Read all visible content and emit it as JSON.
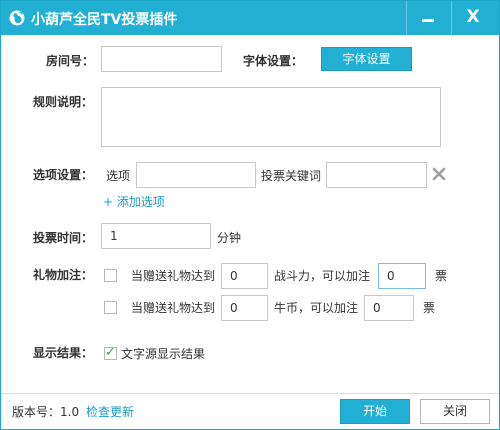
{
  "window": {
    "title": "小葫芦全民TV投票插件",
    "accent": "#21b0d4"
  },
  "form": {
    "room_label": "房间号：",
    "room_value": "",
    "font_label": "字体设置：",
    "font_button": "字体设置",
    "rules_label": "规则说明：",
    "rules_value": "",
    "options_label": "选项设置：",
    "option_prefix": "选项",
    "option_value": "",
    "keyword_prefix": "投票关键词",
    "keyword_value": "",
    "add_option": "+ 添加选项",
    "time_label": "投票时间：",
    "time_value": "1",
    "time_unit": "分钟",
    "gift_label": "礼物加注：",
    "gift_rules": [
      {
        "checked": false,
        "prefix": "当赠送礼物达到",
        "threshold": "0",
        "unit_text": "战斗力，可以加注",
        "votes": "0",
        "suffix": "票"
      },
      {
        "checked": false,
        "prefix": "当赠送礼物达到",
        "threshold": "0",
        "unit_text": "牛币，可以加注",
        "votes": "0",
        "suffix": "票"
      }
    ],
    "display_label": "显示结果：",
    "display_checked": true,
    "display_text": "文字源显示结果"
  },
  "footer": {
    "version_label": "版本号：1.0",
    "check_update": "检查更新",
    "start_button": "开始",
    "close_button": "关闭"
  }
}
